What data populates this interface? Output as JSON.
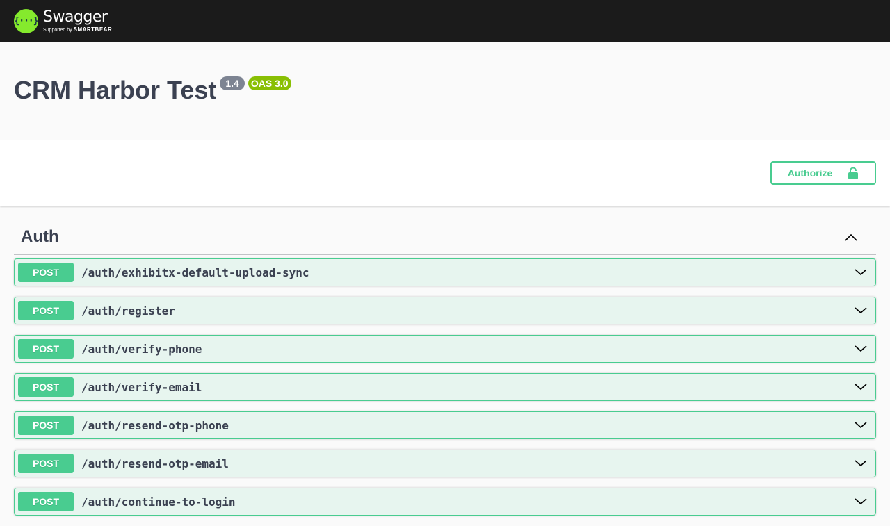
{
  "topbar": {
    "logo_mark": "{···}",
    "logo_name": "Swagger",
    "logo_sub_prefix": "Supported by",
    "logo_sub_brand": "SMARTBEAR"
  },
  "info": {
    "title": "CRM Harbor Test",
    "version": "1.4",
    "oas": "OAS 3.0"
  },
  "scheme": {
    "authorize_label": "Authorize"
  },
  "tag": {
    "name": "Auth",
    "operations": [
      {
        "method": "POST",
        "path": "/auth/exhibitx-default-upload-sync"
      },
      {
        "method": "POST",
        "path": "/auth/register"
      },
      {
        "method": "POST",
        "path": "/auth/verify-phone"
      },
      {
        "method": "POST",
        "path": "/auth/verify-email"
      },
      {
        "method": "POST",
        "path": "/auth/resend-otp-phone"
      },
      {
        "method": "POST",
        "path": "/auth/resend-otp-email"
      },
      {
        "method": "POST",
        "path": "/auth/continue-to-login"
      }
    ]
  },
  "colors": {
    "topbar": "#1b1b1b",
    "logo_green": "#85ea2d",
    "post_green": "#49cc90",
    "version_badge": "#7d8492",
    "oas_badge": "#89bf04",
    "text": "#3b4151"
  },
  "icons": {
    "lock": "lock-icon",
    "tag_toggle": "chevron-up-icon",
    "op_toggle": "chevron-down-icon"
  }
}
